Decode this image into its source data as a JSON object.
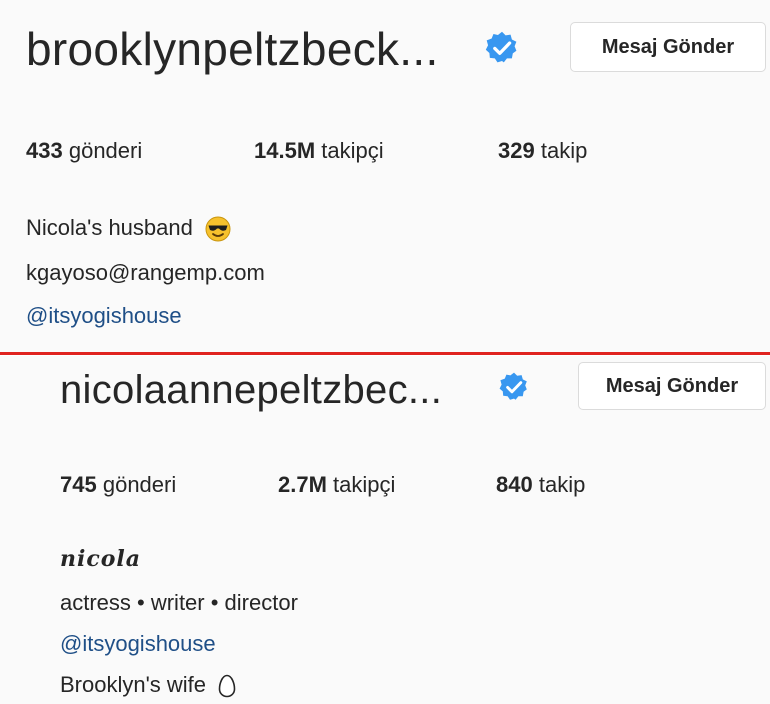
{
  "profiles": [
    {
      "username": "brooklynpeltzbeck...",
      "message_button": "Mesaj Gönder",
      "stats": [
        {
          "value": "433",
          "label": "gönderi"
        },
        {
          "value": "14.5M",
          "label": "takipçi"
        },
        {
          "value": "329",
          "label": "takip"
        }
      ],
      "bio": {
        "line1": "Nicola's husband",
        "line1_emoji": "sunglasses-face-emoji",
        "email": "kgayoso@rangemp.com",
        "mention": "@itsyogishouse"
      }
    },
    {
      "username": "nicolaannepeltzbec...",
      "message_button": "Mesaj Gönder",
      "stats": [
        {
          "value": "745",
          "label": "gönderi"
        },
        {
          "value": "2.7M",
          "label": "takipçi"
        },
        {
          "value": "840",
          "label": "takip"
        }
      ],
      "bio": {
        "name": "nicola",
        "line1": "actress • writer • director",
        "mention": "@itsyogishouse",
        "line3": "Brooklyn's wife",
        "line3_emoji": "egg-emoji"
      }
    }
  ],
  "colors": {
    "verified": "#3897f0",
    "link": "#1f4f87",
    "divider": "#e0231f"
  }
}
